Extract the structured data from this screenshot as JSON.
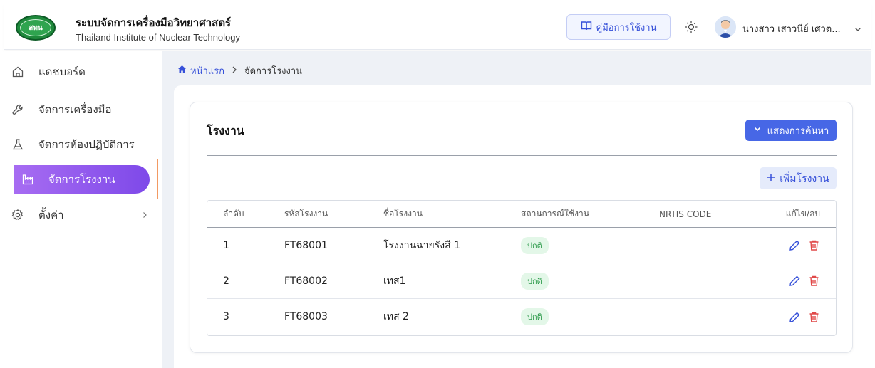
{
  "header": {
    "logo_text": "สทน",
    "title": "ระบบจัดการเครื่องมือวิทยาศาสตร์",
    "subtitle": "Thailand Institute of Nuclear Technology",
    "manual_label": "คู่มือการใช้งาน",
    "user_name": "นางสาว เสาวนีย์ เศวต..."
  },
  "sidebar": {
    "items": [
      {
        "label": "แดชบอร์ด",
        "icon": "home-icon"
      },
      {
        "label": "จัดการเครื่องมือ",
        "icon": "wrench-icon"
      },
      {
        "label": "จัดการห้องปฏิบัติการ",
        "icon": "flask-icon"
      },
      {
        "label": "จัดการโรงงาน",
        "icon": "factory-icon",
        "active": true
      },
      {
        "label": "ตั้งค่า",
        "icon": "gear-icon"
      }
    ]
  },
  "breadcrumb": {
    "home": "หน้าแรก",
    "current": "จัดการโรงงาน"
  },
  "card": {
    "title": "โรงงาน",
    "search_label": "แสดงการค้นหา",
    "add_label": "เพิ่มโรงงาน"
  },
  "table": {
    "headers": [
      "ลำดับ",
      "รหัสโรงงาน",
      "ชื่อโรงงาน",
      "สถานการณ์ใช้งาน",
      "NRTIS CODE",
      "แก้ไข/ลบ"
    ],
    "rows": [
      {
        "no": "1",
        "code": "FT68001",
        "name": "โรงงานฉายรังสี 1",
        "status": "ปกติ",
        "nrtis": ""
      },
      {
        "no": "2",
        "code": "FT68002",
        "name": "เทส1",
        "status": "ปกติ",
        "nrtis": ""
      },
      {
        "no": "3",
        "code": "FT68003",
        "name": "เทส 2",
        "status": "ปกติ",
        "nrtis": ""
      }
    ]
  },
  "colors": {
    "accent": "#4767e6",
    "active_nav_start": "#a76cf2",
    "active_nav_end": "#7e49e9",
    "status_green": "#2c9a4a",
    "delete_red": "#e04848"
  }
}
